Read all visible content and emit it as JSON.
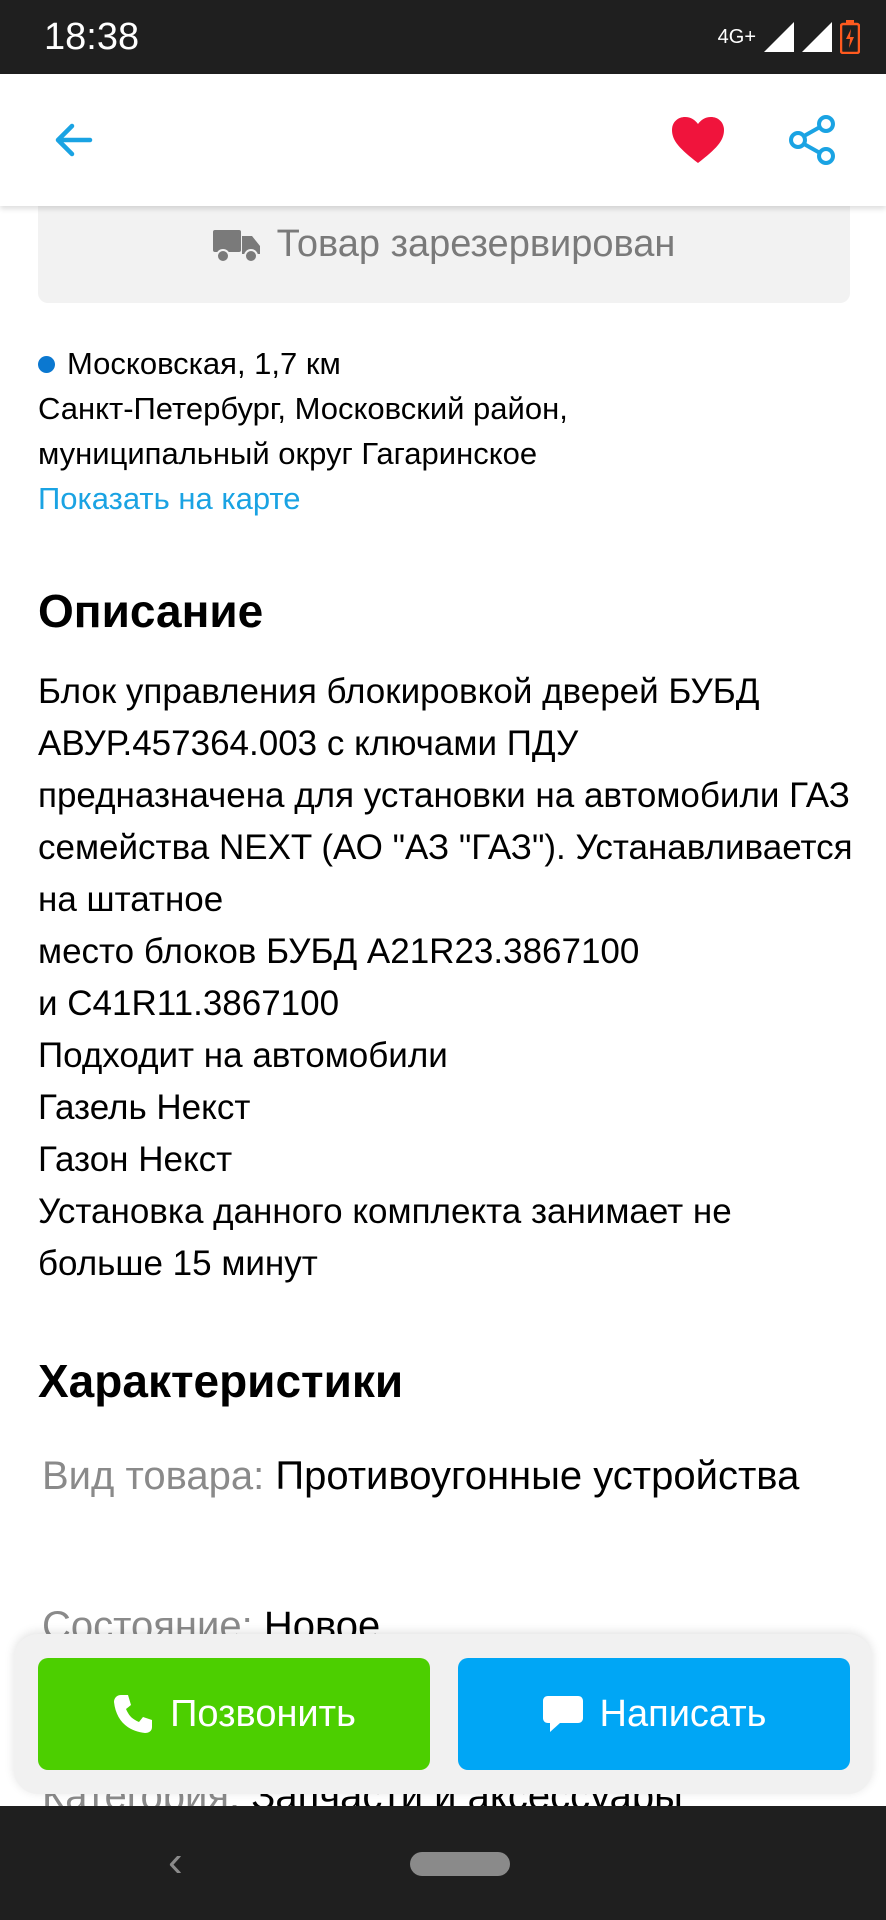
{
  "status_bar": {
    "time": "18:38",
    "network": "4G+"
  },
  "app_bar": {
    "back_icon": "arrow-left-icon",
    "favorite_icon": "heart-icon",
    "share_icon": "share-icon",
    "colors": {
      "accent": "#1aa3e3",
      "favorite": "#f0143c"
    }
  },
  "reserved": {
    "icon": "truck-icon",
    "label": "Товар зарезервирован"
  },
  "location": {
    "metro": "Московская, 1,7 км",
    "address_line1": "Санкт-Петербург, Московский район,",
    "address_line2": "муниципальный округ Гагаринское",
    "map_link": "Показать на карте"
  },
  "description": {
    "title": "Описание",
    "text": "Блок управления блокировкой дверей БУБД АВУР.457364.003 с ключами ПДУ\nпредназначена для установки  на автомобили ГАЗ семейства NEXT (АО \"АЗ \"ГАЗ\").  Устанавливается на штатное\nместо блоков БУБД А21R23.3867100\nи С41R11.3867100\nПодходит на автомобили\nГазель Некст\nГазон Некст\nУстановка данного комплекта занимает не больше 15 минут"
  },
  "characteristics": {
    "title": "Характеристики",
    "items": [
      {
        "key": "Вид товара:",
        "value": "Противоугонные устройства"
      },
      {
        "key": "Состояние:",
        "value": "Новое"
      },
      {
        "key": "Категория:",
        "value": "Запчасти и аксессуары"
      }
    ]
  },
  "actions": {
    "call": {
      "label": "Позвонить",
      "icon": "phone-icon",
      "color": "#4ccf00"
    },
    "write": {
      "label": "Написать",
      "icon": "chat-icon",
      "color": "#00a6f5"
    }
  }
}
